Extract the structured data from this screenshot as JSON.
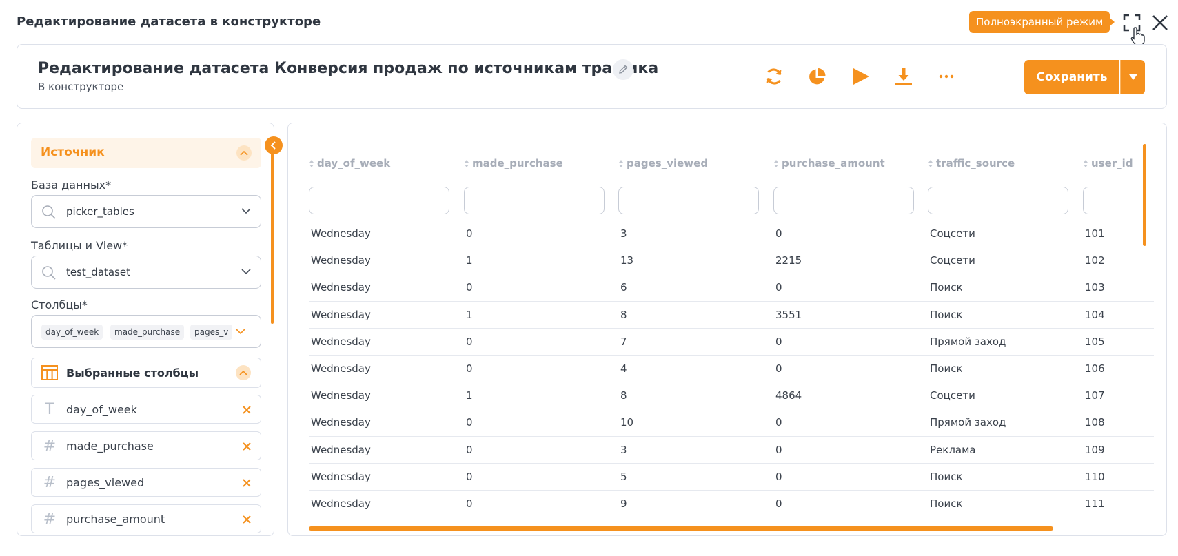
{
  "modal": {
    "title": "Редактирование датасета в конструкторе",
    "tooltip": "Полноэкранный режим"
  },
  "header": {
    "title": "Редактирование датасета Конверсия продаж по источникам трафика",
    "subtitle": "В конструкторе",
    "save_label": "Сохранить"
  },
  "source": {
    "section_label": "Источник",
    "db_label": "База данных*",
    "db_value": "picker_tables",
    "tables_label": "Таблицы и View*",
    "tables_value": "test_dataset",
    "columns_label": "Столбцы*",
    "column_tags": [
      "day_of_week",
      "made_purchase",
      "pages_v"
    ],
    "chosen_label": "Выбранные столбцы",
    "chosen": [
      {
        "type": "T",
        "name": "day_of_week"
      },
      {
        "type": "#",
        "name": "made_purchase"
      },
      {
        "type": "#",
        "name": "pages_viewed"
      },
      {
        "type": "#",
        "name": "purchase_amount"
      }
    ]
  },
  "table": {
    "columns": [
      "day_of_week",
      "made_purchase",
      "pages_viewed",
      "purchase_amount",
      "traffic_source",
      "user_id"
    ],
    "rows": [
      [
        "Wednesday",
        "0",
        "3",
        "0",
        "Соцсети",
        "101"
      ],
      [
        "Wednesday",
        "1",
        "13",
        "2215",
        "Соцсети",
        "102"
      ],
      [
        "Wednesday",
        "0",
        "6",
        "0",
        "Поиск",
        "103"
      ],
      [
        "Wednesday",
        "1",
        "8",
        "3551",
        "Поиск",
        "104"
      ],
      [
        "Wednesday",
        "0",
        "7",
        "0",
        "Прямой заход",
        "105"
      ],
      [
        "Wednesday",
        "0",
        "4",
        "0",
        "Поиск",
        "106"
      ],
      [
        "Wednesday",
        "1",
        "8",
        "4864",
        "Соцсети",
        "107"
      ],
      [
        "Wednesday",
        "0",
        "10",
        "0",
        "Прямой заход",
        "108"
      ],
      [
        "Wednesday",
        "0",
        "3",
        "0",
        "Реклама",
        "109"
      ],
      [
        "Wednesday",
        "0",
        "5",
        "0",
        "Поиск",
        "110"
      ],
      [
        "Wednesday",
        "0",
        "9",
        "0",
        "Поиск",
        "111"
      ]
    ]
  },
  "colors": {
    "accent": "#f5911e",
    "accent_light": "#fef4e8",
    "border": "#dde1ea",
    "text": "#2f3640",
    "muted": "#a7adb8"
  },
  "icons": [
    "fullscreen-icon",
    "close-icon",
    "pencil-icon",
    "refresh-icon",
    "pie-chart-icon",
    "play-icon",
    "download-icon",
    "more-icon",
    "search-icon",
    "chevron-down-icon",
    "chevron-up-icon",
    "chevron-left-icon",
    "table-icon",
    "remove-icon",
    "sort-icon"
  ]
}
